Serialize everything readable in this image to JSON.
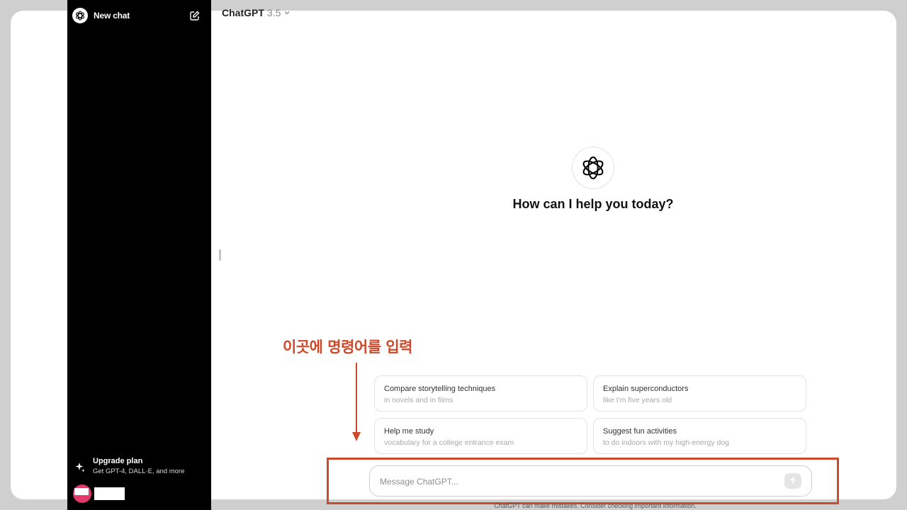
{
  "sidebar": {
    "new_chat_label": "New chat",
    "upgrade": {
      "title": "Upgrade plan",
      "subtitle": "Get GPT-4, DALL·E, and more"
    }
  },
  "header": {
    "model_name": "ChatGPT",
    "model_version": "3.5"
  },
  "main": {
    "greeting": "How can I help you today?",
    "suggestions": [
      {
        "title": "Compare storytelling techniques",
        "subtitle": "in novels and in films"
      },
      {
        "title": "Explain superconductors",
        "subtitle": "like I'm five years old"
      },
      {
        "title": "Help me study",
        "subtitle": "vocabulary for a college entrance exam"
      },
      {
        "title": "Suggest fun activities",
        "subtitle": "to do indoors with my high-energy dog"
      }
    ]
  },
  "composer": {
    "placeholder": "Message ChatGPT...",
    "value": ""
  },
  "footer": {
    "disclaimer": "ChatGPT can make mistakes. Consider checking important information."
  },
  "annotation": {
    "text": "이곳에 명령어를 입력",
    "color": "#cc4a2a"
  }
}
